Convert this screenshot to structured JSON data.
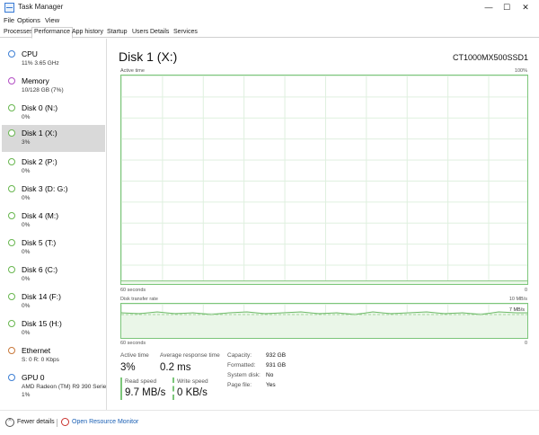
{
  "window": {
    "title": "Task Manager"
  },
  "menu": [
    "File",
    "Options",
    "View"
  ],
  "tabs": [
    "Processes",
    "Performance",
    "App history",
    "Startup",
    "Users",
    "Details",
    "Services"
  ],
  "sidebar": [
    {
      "name": "CPU",
      "sub": "11%  3.65 GHz",
      "color": "#3d7fd4"
    },
    {
      "name": "Memory",
      "sub": "10/128 GB (7%)",
      "color": "#b24dc4"
    },
    {
      "name": "Disk 0 (N:)",
      "sub": "0%",
      "color": "#68b74f"
    },
    {
      "name": "Disk 1 (X:)",
      "sub": "3%",
      "color": "#68b74f"
    },
    {
      "name": "Disk 2 (P:)",
      "sub": "0%",
      "color": "#68b74f"
    },
    {
      "name": "Disk 3 (D: G:)",
      "sub": "0%",
      "color": "#68b74f"
    },
    {
      "name": "Disk 4 (M:)",
      "sub": "0%",
      "color": "#68b74f"
    },
    {
      "name": "Disk 5 (T:)",
      "sub": "0%",
      "color": "#68b74f"
    },
    {
      "name": "Disk 6 (C:)",
      "sub": "0%",
      "color": "#68b74f"
    },
    {
      "name": "Disk 14 (F:)",
      "sub": "0%",
      "color": "#68b74f"
    },
    {
      "name": "Disk 15 (H:)",
      "sub": "0%",
      "color": "#68b74f"
    },
    {
      "name": "Ethernet",
      "sub": "S: 0  R: 0 Kbps",
      "color": "#c8783a"
    },
    {
      "name": "GPU 0",
      "sub": "AMD Radeon (TM) R9 390 Serie",
      "sub2": "1%",
      "color": "#3d7fd4"
    }
  ],
  "main": {
    "title": "Disk 1 (X:)",
    "model": "CT1000MX500SSD1",
    "graph1": {
      "top_left": "Active time",
      "top_right": "100%",
      "bottom_left": "60 seconds",
      "bottom_right": "0"
    },
    "graph2": {
      "top_left": "Disk transfer rate",
      "top_right": "10 MB/s",
      "inner_right": "7 MB/s",
      "bottom_left": "60 seconds",
      "bottom_right": "0"
    },
    "stats": {
      "active_time_label": "Active time",
      "active_time_value": "3%",
      "avg_response_label": "Average response time",
      "avg_response_value": "0.2 ms",
      "read_label": "Read speed",
      "read_value": "9.7 MB/s",
      "write_label": "Write speed",
      "write_value": "0 KB/s"
    },
    "props": [
      {
        "label": "Capacity:",
        "value": "932 GB"
      },
      {
        "label": "Formatted:",
        "value": "931 GB"
      },
      {
        "label": "System disk:",
        "value": "No"
      },
      {
        "label": "Page file:",
        "value": "Yes"
      }
    ]
  },
  "footer": {
    "fewer_details": "Fewer details",
    "open_resource_monitor": "Open Resource Monitor"
  }
}
